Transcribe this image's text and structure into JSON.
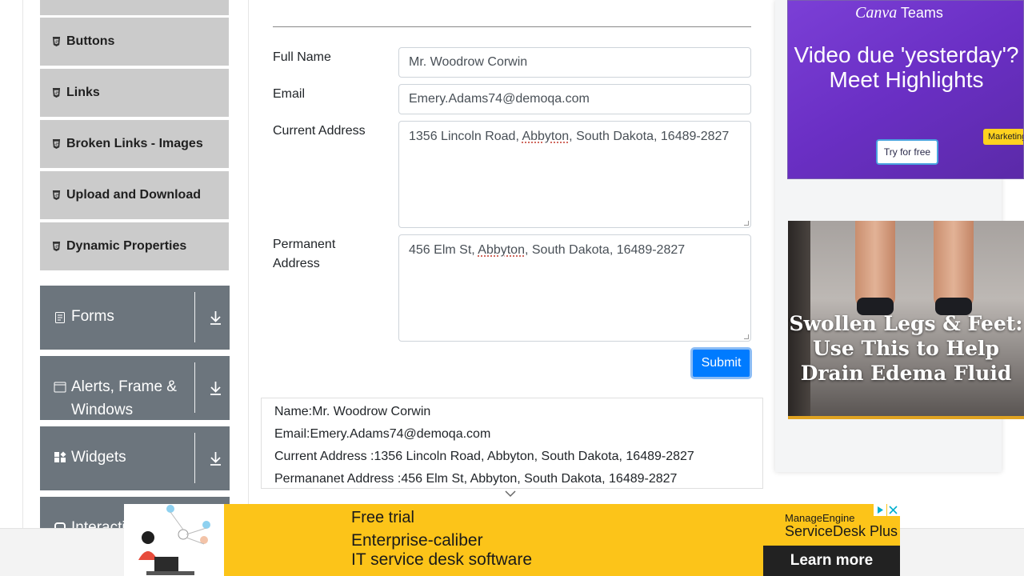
{
  "sidebar": {
    "sub_items": [
      {
        "label": "Buttons"
      },
      {
        "label": "Links"
      },
      {
        "label": "Broken Links - Images"
      },
      {
        "label": "Upload and Download"
      },
      {
        "label": "Dynamic Properties"
      }
    ],
    "groups": [
      {
        "label": "Forms",
        "icon": "form-icon"
      },
      {
        "label": "Alerts, Frame & Windows",
        "icon": "window-icon"
      },
      {
        "label": "Widgets",
        "icon": "widgets-icon"
      },
      {
        "label": "Interactions",
        "icon": "interactions-icon"
      }
    ]
  },
  "form": {
    "full_name_label": "Full Name",
    "full_name_value": "Mr. Woodrow Corwin",
    "email_label": "Email",
    "email_value": "Emery.Adams74@demoqa.com",
    "current_address_label": "Current Address",
    "current_address": {
      "pre": "1356 Lincoln Road, ",
      "word": "Abbyton",
      "post": ", South Dakota, 16489-2827"
    },
    "permanent_address_label_1": "Permanent",
    "permanent_address_label_2": "Address",
    "permanent_address": {
      "pre": "456 Elm St, ",
      "word": "Abbyton",
      "post": ", South Dakota, 16489-2827"
    },
    "submit_label": "Submit"
  },
  "output": {
    "name": "Name:Mr. Woodrow Corwin",
    "email": "Email:Emery.Adams74@demoqa.com",
    "current_address": "Current Address :1356 Lincoln Road, Abbyton, South Dakota, 16489-2827",
    "permanent_address": "Permananet Address :456 Elm St, Abbyton, South Dakota, 16489-2827"
  },
  "ads": {
    "canva": {
      "brand": "Canva",
      "brand_suffix": " Teams",
      "headline": "Video due 'yesterday'? Meet Highlights",
      "cta": "Try for free",
      "tag": "Marketing"
    },
    "legs": {
      "headline": "Swollen Legs & Feet: Use This to Help Drain Edema Fluid"
    },
    "banner": {
      "line1": "Free trial",
      "line2": "Enterprise-caliber",
      "line3": "IT service desk software",
      "brand": "ManageEngine",
      "brand_product": "ServiceDesk Plus",
      "cta": "Learn more"
    }
  },
  "colors": {
    "primary": "#007bff",
    "sidebar_group": "#6c757d",
    "sidebar_sub": "#cbcbcb",
    "banner": "#fcc419"
  }
}
